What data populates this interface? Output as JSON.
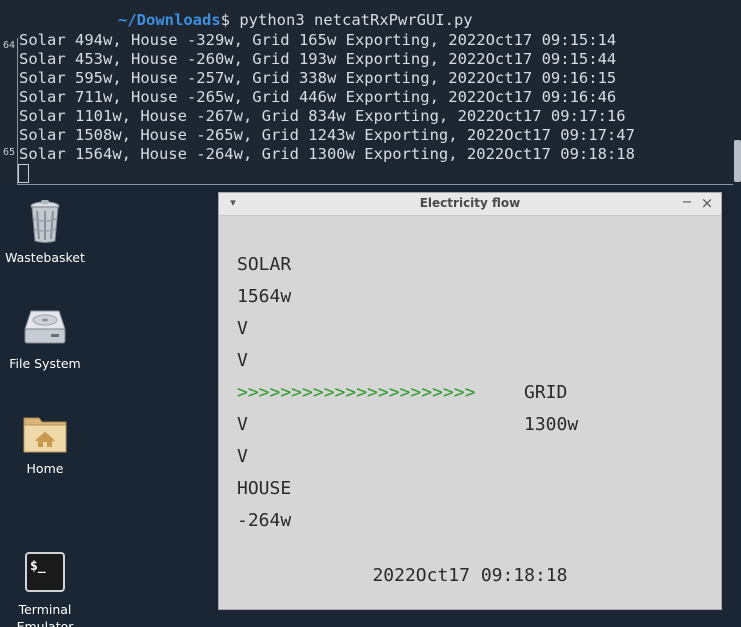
{
  "terminal": {
    "prompt_path": "~/Downloads",
    "prompt_symbol": "$",
    "command": "python3 netcatRxPwrGUI.py",
    "gutter_top": "64",
    "gutter_bottom": "65",
    "lines": [
      "Solar 494w, House -329w, Grid 165w Exporting, 2022Oct17 09:15:14",
      "Solar 453w, House -260w, Grid 193w Exporting, 2022Oct17 09:15:44",
      "Solar 595w, House -257w, Grid 338w Exporting, 2022Oct17 09:16:15",
      "Solar 711w, House -265w, Grid 446w Exporting, 2022Oct17 09:16:46",
      "Solar 1101w, House -267w, Grid 834w Exporting, 2022Oct17 09:17:16",
      "Solar 1508w, House -265w, Grid 1243w Exporting, 2022Oct17 09:17:47",
      "Solar 1564w, House -264w, Grid 1300w Exporting, 2022Oct17 09:18:18"
    ]
  },
  "desktop": {
    "icons": [
      {
        "label": "Wastebasket",
        "icon": "trash-icon"
      },
      {
        "label": "File System",
        "icon": "drive-icon"
      },
      {
        "label": "Home",
        "icon": "home-folder-icon"
      },
      {
        "label": "Terminal\nEmulator",
        "icon": "terminal-icon"
      }
    ]
  },
  "window": {
    "title": "Electricity flow",
    "menu_glyph": "▾",
    "minimize_glyph": "−",
    "close_glyph": "×",
    "solar_label": "SOLAR",
    "solar_value": "1564w",
    "down_arrow": "V",
    "flow_arrow": ">>>>>>>>>>>>>>>>>>>>>>",
    "grid_label": "GRID",
    "grid_value": "1300w",
    "house_label": "HOUSE",
    "house_value": "-264w",
    "timestamp": "2022Oct17 09:18:18",
    "arrow_color": "#2f9a2f"
  }
}
